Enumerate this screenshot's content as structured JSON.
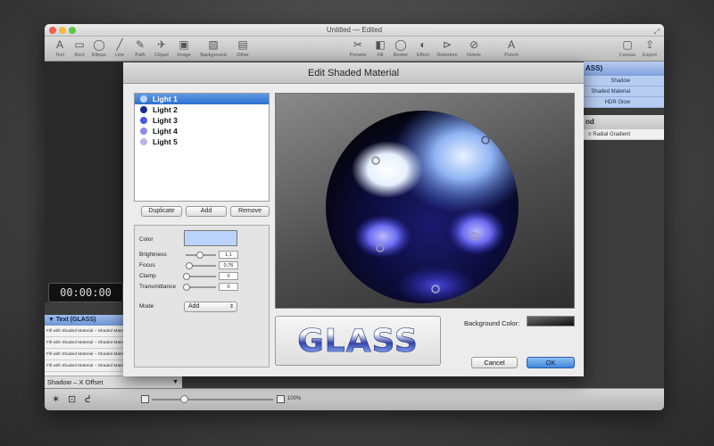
{
  "window": {
    "title": "Untitled — Edited"
  },
  "toolbar": {
    "left": [
      {
        "label": "Text",
        "icon": "text-tool-icon",
        "glyph": "A"
      },
      {
        "label": "Rect",
        "icon": "rect-tool-icon",
        "glyph": "▭"
      },
      {
        "label": "Ellipse",
        "icon": "ellipse-tool-icon",
        "glyph": "◯"
      },
      {
        "label": "Line",
        "icon": "line-tool-icon",
        "glyph": "╱"
      },
      {
        "label": "Path",
        "icon": "path-tool-icon",
        "glyph": "✎"
      },
      {
        "label": "Clipart",
        "icon": "clipart-tool-icon",
        "glyph": "✈"
      },
      {
        "label": "Image",
        "icon": "image-tool-icon",
        "glyph": "▣"
      },
      {
        "label": "Background",
        "icon": "background-tool-icon",
        "glyph": "▨"
      },
      {
        "label": "Other",
        "icon": "other-tool-icon",
        "glyph": "▤"
      }
    ],
    "middle": [
      {
        "label": "Presets",
        "icon": "presets-icon",
        "glyph": "✂"
      },
      {
        "label": "Fill",
        "icon": "fill-icon",
        "glyph": "◧"
      },
      {
        "label": "Border",
        "icon": "border-icon",
        "glyph": "◯"
      },
      {
        "label": "Effect",
        "icon": "effect-icon",
        "glyph": "◐"
      },
      {
        "label": "Distortion",
        "icon": "distortion-icon",
        "glyph": "⊳"
      },
      {
        "label": "Delete",
        "icon": "delete-icon",
        "glyph": "⊘"
      },
      {
        "label": "Punch",
        "icon": "punch-icon",
        "glyph": "A"
      }
    ],
    "right": [
      {
        "label": "Canvas",
        "icon": "canvas-icon",
        "glyph": "▢"
      },
      {
        "label": "Export",
        "icon": "export-icon",
        "glyph": "⇪"
      }
    ]
  },
  "timer": {
    "value": "00:00:00"
  },
  "layers": {
    "header": "Text (GLASS)",
    "rows": [
      "Fill with Shaded Material – Shaded Material",
      "Fill with Shaded Material – Shaded Material",
      "Fill with Shaded Material – Shaded Material",
      "Fill with Shaded Material – Shaded Material"
    ]
  },
  "shadow_x": {
    "label": "Shadow – X Offset"
  },
  "right_panel": {
    "header1": "ASS)",
    "rows1": [
      "Shadow",
      "Shaded Material",
      "HDR Glow"
    ],
    "header2": "nd",
    "rows2": [
      "n Radial Gradient"
    ]
  },
  "zoom": {
    "value": "100%"
  },
  "sheet": {
    "title": "Edit Shaded Material",
    "lights": [
      {
        "label": "Light 1",
        "color": "#bcd3fb",
        "selected": true
      },
      {
        "label": "Light 2",
        "color": "#1a2a8c"
      },
      {
        "label": "Light 3",
        "color": "#4a58e0"
      },
      {
        "label": "Light 4",
        "color": "#8f8cf0"
      },
      {
        "label": "Light 5",
        "color": "#b7b6f4"
      }
    ],
    "buttons": {
      "duplicate": "Duplicate",
      "add": "Add",
      "remove": "Remove"
    },
    "props": {
      "color_label": "Color",
      "color_value": "#bcd3fb",
      "brightness_label": "Brightness",
      "brightness_value": "1,1",
      "focus_label": "Focus",
      "focus_value": "0,76",
      "clamp_label": "Clamp",
      "clamp_value": "0",
      "transmittance_label": "Transmittance",
      "transmittance_value": "0",
      "mode_label": "Mode",
      "mode_value": "Add"
    },
    "preview_text": "GLASS",
    "background_color_label": "Background Color:",
    "cancel": "Cancel",
    "ok": "OK"
  }
}
